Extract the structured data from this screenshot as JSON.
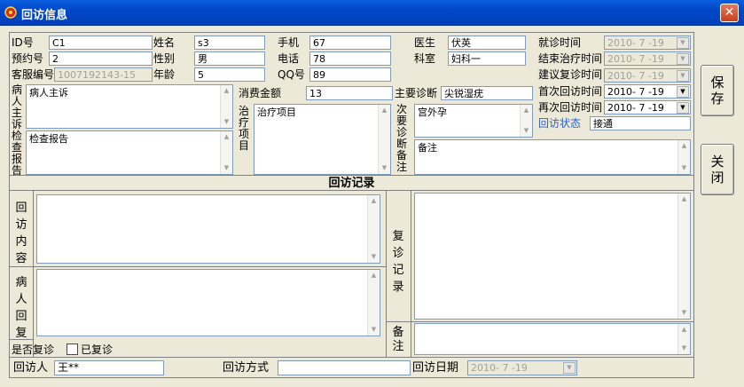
{
  "window": {
    "title": "回访信息",
    "close_glyph": "✕"
  },
  "labels": {
    "id": "ID号",
    "appointment": "预约号",
    "customer_no": "客服编号",
    "name": "姓名",
    "gender": "性别",
    "age": "年龄",
    "mobile": "手机",
    "phone": "电话",
    "qq": "QQ号",
    "doctor": "医生",
    "department": "科室",
    "visit_time": "就诊时间",
    "end_treatment_time": "结束治疗时间",
    "suggest_revisit_time": "建议复诊时间",
    "first_followup_time": "首次回访时间",
    "second_followup_time": "再次回访时间",
    "followup_status": "回访状态",
    "consumption": "消费金额",
    "main_diagnosis": "主要诊断",
    "chief_complaint": "病人主诉",
    "exam_report": "检查报告",
    "treatment": "治疗项目",
    "secondary_diagnosis": "次要诊断",
    "remark": "备注",
    "followup_record": "回访记录",
    "followup_content": "回访内容",
    "patient_reply": "病人回复",
    "revisit_record": "复诊记录",
    "remark2": "备注",
    "revisited_question": "是否复诊",
    "revisited": "已复诊",
    "visitor": "回访人",
    "followup_method": "回访方式",
    "followup_date": "回访日期"
  },
  "values": {
    "id": "C1",
    "appointment": "2",
    "customer_no": "1007192143-15",
    "name": "s3",
    "gender": "男",
    "age": "5",
    "mobile": "67",
    "phone": "78",
    "qq": "89",
    "doctor": "伏英",
    "department": "妇科一",
    "visit_time": "2010- 7 -19",
    "end_treatment_time": "2010- 7 -19",
    "suggest_revisit_time": "2010- 7 -19",
    "first_followup_time": "2010- 7 -19",
    "second_followup_time": "2010- 7 -19",
    "followup_status": "接通",
    "consumption": "13",
    "main_diagnosis": "尖锐湿疣",
    "chief_complaint": "病人主诉",
    "exam_report": "检查报告",
    "treatment": "治疗项目",
    "secondary_diagnosis": "宫外孕",
    "remark": "备注",
    "followup_content": "",
    "patient_reply": "",
    "revisit_record": "",
    "remark2": "",
    "visitor": "王**",
    "followup_method": "",
    "followup_date": "2010- 7 -19"
  },
  "buttons": {
    "save": "保存",
    "close": "关闭"
  },
  "colors": {
    "titlebar": "#0047c8",
    "status_label": "#3060c0"
  }
}
